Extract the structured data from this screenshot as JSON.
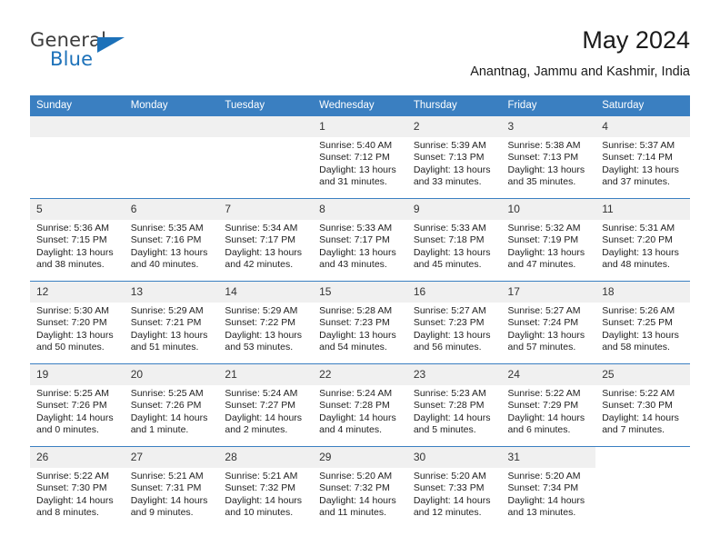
{
  "logo": {
    "word_one": "General",
    "word_two": "Blue",
    "flag_icon": "triangle-flag-icon",
    "brand_color": "#1c71b9"
  },
  "header": {
    "month_title": "May 2024",
    "location": "Anantnag, Jammu and Kashmir, India"
  },
  "calendar": {
    "header_color": "#3a7fc1",
    "daynum_band_color": "#f0f0f0",
    "weekday_headers": [
      "Sunday",
      "Monday",
      "Tuesday",
      "Wednesday",
      "Thursday",
      "Friday",
      "Saturday"
    ],
    "weeks": [
      [
        {
          "day": "",
          "blank": true,
          "sunrise": "",
          "sunset": "",
          "daylight_line1": "",
          "daylight_line2": ""
        },
        {
          "day": "",
          "blank": true,
          "sunrise": "",
          "sunset": "",
          "daylight_line1": "",
          "daylight_line2": ""
        },
        {
          "day": "",
          "blank": true,
          "sunrise": "",
          "sunset": "",
          "daylight_line1": "",
          "daylight_line2": ""
        },
        {
          "day": "1",
          "blank": false,
          "sunrise": "Sunrise: 5:40 AM",
          "sunset": "Sunset: 7:12 PM",
          "daylight_line1": "Daylight: 13 hours",
          "daylight_line2": "and 31 minutes."
        },
        {
          "day": "2",
          "blank": false,
          "sunrise": "Sunrise: 5:39 AM",
          "sunset": "Sunset: 7:13 PM",
          "daylight_line1": "Daylight: 13 hours",
          "daylight_line2": "and 33 minutes."
        },
        {
          "day": "3",
          "blank": false,
          "sunrise": "Sunrise: 5:38 AM",
          "sunset": "Sunset: 7:13 PM",
          "daylight_line1": "Daylight: 13 hours",
          "daylight_line2": "and 35 minutes."
        },
        {
          "day": "4",
          "blank": false,
          "sunrise": "Sunrise: 5:37 AM",
          "sunset": "Sunset: 7:14 PM",
          "daylight_line1": "Daylight: 13 hours",
          "daylight_line2": "and 37 minutes."
        }
      ],
      [
        {
          "day": "5",
          "blank": false,
          "sunrise": "Sunrise: 5:36 AM",
          "sunset": "Sunset: 7:15 PM",
          "daylight_line1": "Daylight: 13 hours",
          "daylight_line2": "and 38 minutes."
        },
        {
          "day": "6",
          "blank": false,
          "sunrise": "Sunrise: 5:35 AM",
          "sunset": "Sunset: 7:16 PM",
          "daylight_line1": "Daylight: 13 hours",
          "daylight_line2": "and 40 minutes."
        },
        {
          "day": "7",
          "blank": false,
          "sunrise": "Sunrise: 5:34 AM",
          "sunset": "Sunset: 7:17 PM",
          "daylight_line1": "Daylight: 13 hours",
          "daylight_line2": "and 42 minutes."
        },
        {
          "day": "8",
          "blank": false,
          "sunrise": "Sunrise: 5:33 AM",
          "sunset": "Sunset: 7:17 PM",
          "daylight_line1": "Daylight: 13 hours",
          "daylight_line2": "and 43 minutes."
        },
        {
          "day": "9",
          "blank": false,
          "sunrise": "Sunrise: 5:33 AM",
          "sunset": "Sunset: 7:18 PM",
          "daylight_line1": "Daylight: 13 hours",
          "daylight_line2": "and 45 minutes."
        },
        {
          "day": "10",
          "blank": false,
          "sunrise": "Sunrise: 5:32 AM",
          "sunset": "Sunset: 7:19 PM",
          "daylight_line1": "Daylight: 13 hours",
          "daylight_line2": "and 47 minutes."
        },
        {
          "day": "11",
          "blank": false,
          "sunrise": "Sunrise: 5:31 AM",
          "sunset": "Sunset: 7:20 PM",
          "daylight_line1": "Daylight: 13 hours",
          "daylight_line2": "and 48 minutes."
        }
      ],
      [
        {
          "day": "12",
          "blank": false,
          "sunrise": "Sunrise: 5:30 AM",
          "sunset": "Sunset: 7:20 PM",
          "daylight_line1": "Daylight: 13 hours",
          "daylight_line2": "and 50 minutes."
        },
        {
          "day": "13",
          "blank": false,
          "sunrise": "Sunrise: 5:29 AM",
          "sunset": "Sunset: 7:21 PM",
          "daylight_line1": "Daylight: 13 hours",
          "daylight_line2": "and 51 minutes."
        },
        {
          "day": "14",
          "blank": false,
          "sunrise": "Sunrise: 5:29 AM",
          "sunset": "Sunset: 7:22 PM",
          "daylight_line1": "Daylight: 13 hours",
          "daylight_line2": "and 53 minutes."
        },
        {
          "day": "15",
          "blank": false,
          "sunrise": "Sunrise: 5:28 AM",
          "sunset": "Sunset: 7:23 PM",
          "daylight_line1": "Daylight: 13 hours",
          "daylight_line2": "and 54 minutes."
        },
        {
          "day": "16",
          "blank": false,
          "sunrise": "Sunrise: 5:27 AM",
          "sunset": "Sunset: 7:23 PM",
          "daylight_line1": "Daylight: 13 hours",
          "daylight_line2": "and 56 minutes."
        },
        {
          "day": "17",
          "blank": false,
          "sunrise": "Sunrise: 5:27 AM",
          "sunset": "Sunset: 7:24 PM",
          "daylight_line1": "Daylight: 13 hours",
          "daylight_line2": "and 57 minutes."
        },
        {
          "day": "18",
          "blank": false,
          "sunrise": "Sunrise: 5:26 AM",
          "sunset": "Sunset: 7:25 PM",
          "daylight_line1": "Daylight: 13 hours",
          "daylight_line2": "and 58 minutes."
        }
      ],
      [
        {
          "day": "19",
          "blank": false,
          "sunrise": "Sunrise: 5:25 AM",
          "sunset": "Sunset: 7:26 PM",
          "daylight_line1": "Daylight: 14 hours",
          "daylight_line2": "and 0 minutes."
        },
        {
          "day": "20",
          "blank": false,
          "sunrise": "Sunrise: 5:25 AM",
          "sunset": "Sunset: 7:26 PM",
          "daylight_line1": "Daylight: 14 hours",
          "daylight_line2": "and 1 minute."
        },
        {
          "day": "21",
          "blank": false,
          "sunrise": "Sunrise: 5:24 AM",
          "sunset": "Sunset: 7:27 PM",
          "daylight_line1": "Daylight: 14 hours",
          "daylight_line2": "and 2 minutes."
        },
        {
          "day": "22",
          "blank": false,
          "sunrise": "Sunrise: 5:24 AM",
          "sunset": "Sunset: 7:28 PM",
          "daylight_line1": "Daylight: 14 hours",
          "daylight_line2": "and 4 minutes."
        },
        {
          "day": "23",
          "blank": false,
          "sunrise": "Sunrise: 5:23 AM",
          "sunset": "Sunset: 7:28 PM",
          "daylight_line1": "Daylight: 14 hours",
          "daylight_line2": "and 5 minutes."
        },
        {
          "day": "24",
          "blank": false,
          "sunrise": "Sunrise: 5:22 AM",
          "sunset": "Sunset: 7:29 PM",
          "daylight_line1": "Daylight: 14 hours",
          "daylight_line2": "and 6 minutes."
        },
        {
          "day": "25",
          "blank": false,
          "sunrise": "Sunrise: 5:22 AM",
          "sunset": "Sunset: 7:30 PM",
          "daylight_line1": "Daylight: 14 hours",
          "daylight_line2": "and 7 minutes."
        }
      ],
      [
        {
          "day": "26",
          "blank": false,
          "sunrise": "Sunrise: 5:22 AM",
          "sunset": "Sunset: 7:30 PM",
          "daylight_line1": "Daylight: 14 hours",
          "daylight_line2": "and 8 minutes."
        },
        {
          "day": "27",
          "blank": false,
          "sunrise": "Sunrise: 5:21 AM",
          "sunset": "Sunset: 7:31 PM",
          "daylight_line1": "Daylight: 14 hours",
          "daylight_line2": "and 9 minutes."
        },
        {
          "day": "28",
          "blank": false,
          "sunrise": "Sunrise: 5:21 AM",
          "sunset": "Sunset: 7:32 PM",
          "daylight_line1": "Daylight: 14 hours",
          "daylight_line2": "and 10 minutes."
        },
        {
          "day": "29",
          "blank": false,
          "sunrise": "Sunrise: 5:20 AM",
          "sunset": "Sunset: 7:32 PM",
          "daylight_line1": "Daylight: 14 hours",
          "daylight_line2": "and 11 minutes."
        },
        {
          "day": "30",
          "blank": false,
          "sunrise": "Sunrise: 5:20 AM",
          "sunset": "Sunset: 7:33 PM",
          "daylight_line1": "Daylight: 14 hours",
          "daylight_line2": "and 12 minutes."
        },
        {
          "day": "31",
          "blank": false,
          "sunrise": "Sunrise: 5:20 AM",
          "sunset": "Sunset: 7:34 PM",
          "daylight_line1": "Daylight: 14 hours",
          "daylight_line2": "and 13 minutes."
        },
        {
          "day": "",
          "blank": true,
          "void": true,
          "sunrise": "",
          "sunset": "",
          "daylight_line1": "",
          "daylight_line2": ""
        }
      ]
    ]
  }
}
